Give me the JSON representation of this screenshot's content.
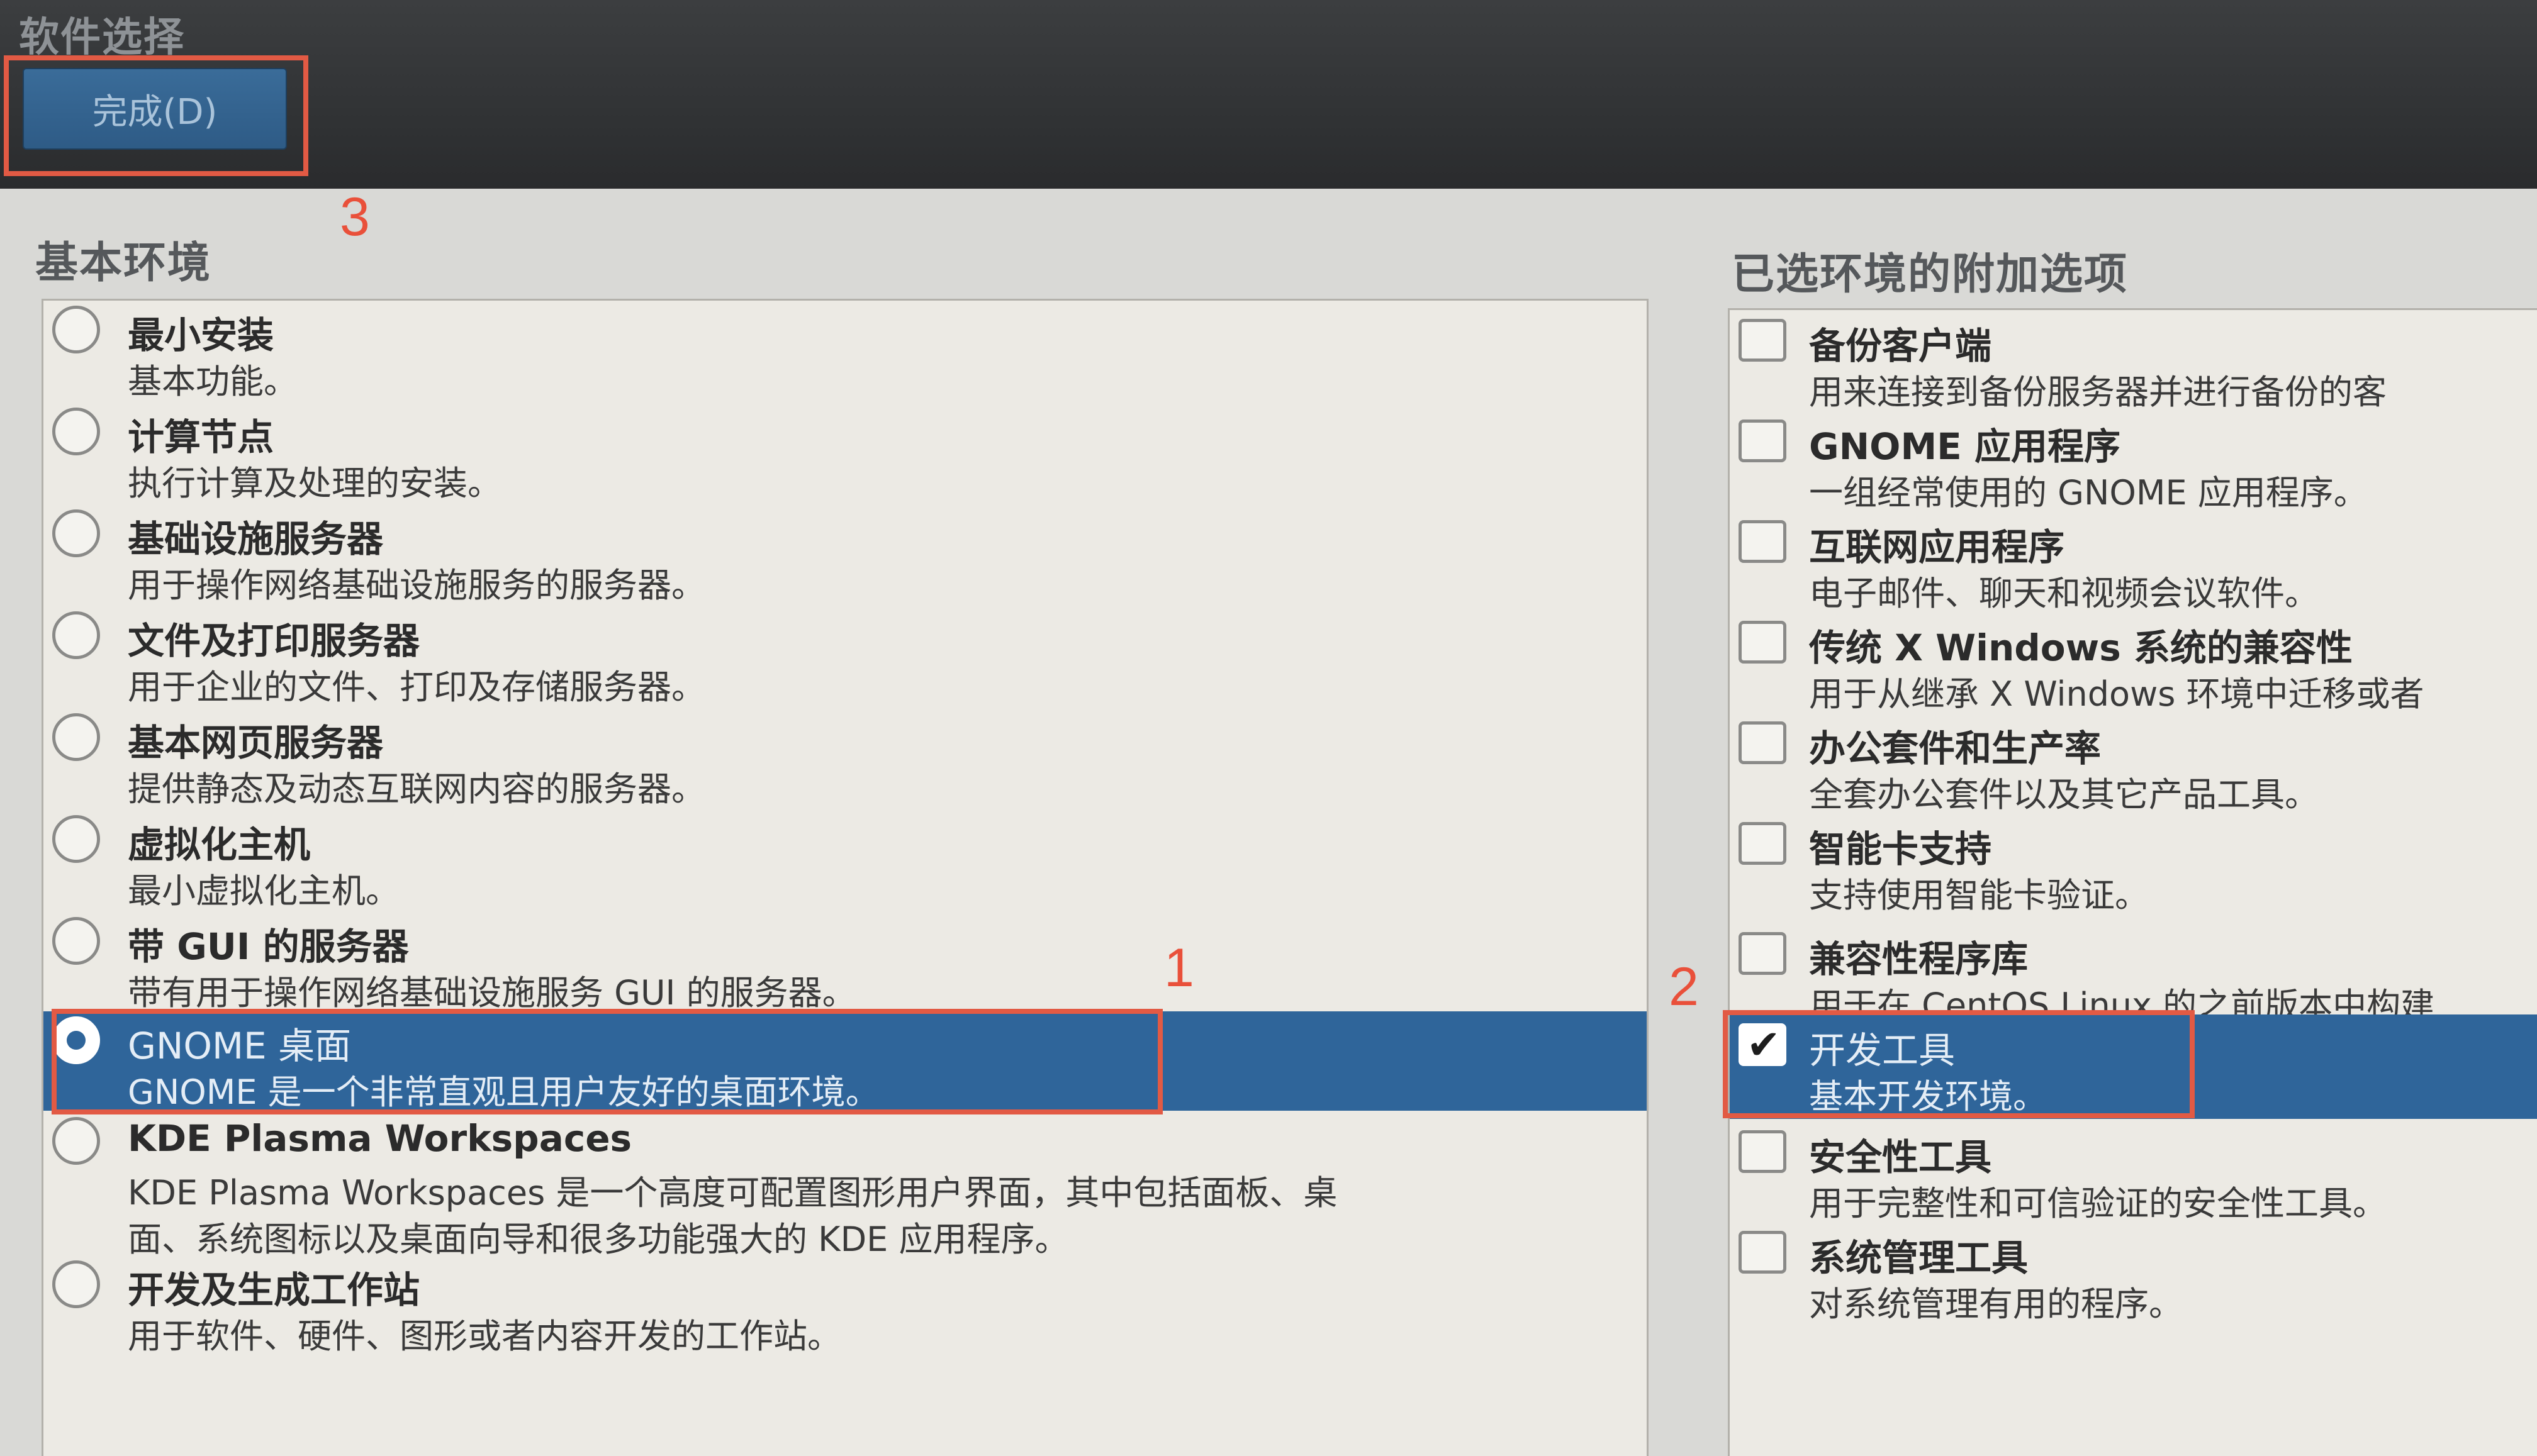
{
  "header": {
    "title": "软件选择",
    "done_button": "完成(D)"
  },
  "annotations": {
    "n1": "1",
    "n2": "2",
    "n3": "3",
    "color": "#e25a44"
  },
  "environments": {
    "label": "基本环境",
    "items": [
      {
        "title": "最小安装",
        "desc": "基本功能。",
        "selected": false
      },
      {
        "title": "计算节点",
        "desc": "执行计算及处理的安装。",
        "selected": false
      },
      {
        "title": "基础设施服务器",
        "desc": "用于操作网络基础设施服务的服务器。",
        "selected": false
      },
      {
        "title": "文件及打印服务器",
        "desc": "用于企业的文件、打印及存储服务器。",
        "selected": false
      },
      {
        "title": "基本网页服务器",
        "desc": "提供静态及动态互联网内容的服务器。",
        "selected": false
      },
      {
        "title": "虚拟化主机",
        "desc": "最小虚拟化主机。",
        "selected": false
      },
      {
        "title": "带 GUI 的服务器",
        "desc": "带有用于操作网络基础设施服务 GUI 的服务器。",
        "selected": false
      },
      {
        "title": "GNOME 桌面",
        "desc": "GNOME 是一个非常直观且用户友好的桌面环境。",
        "selected": true
      },
      {
        "title": "KDE Plasma Workspaces",
        "desc": "KDE Plasma Workspaces 是一个高度可配置图形用户界面，其中包括面板、桌",
        "desc2": "面、系统图标以及桌面向导和很多功能强大的 KDE 应用程序。",
        "selected": false
      },
      {
        "title": "开发及生成工作站",
        "desc": "用于软件、硬件、图形或者内容开发的工作站。",
        "selected": false
      }
    ]
  },
  "addons": {
    "label": "已选环境的附加选项",
    "items": [
      {
        "title": "备份客户端",
        "desc": "用来连接到备份服务器并进行备份的客",
        "checked": false
      },
      {
        "title": "GNOME 应用程序",
        "desc": "一组经常使用的 GNOME 应用程序。",
        "checked": false
      },
      {
        "title": "互联网应用程序",
        "desc": "电子邮件、聊天和视频会议软件。",
        "checked": false
      },
      {
        "title": "传统 X Windows 系统的兼容性",
        "desc": "用于从继承 X Windows 环境中迁移或者",
        "checked": false
      },
      {
        "title": "办公套件和生产率",
        "desc": "全套办公套件以及其它产品工具。",
        "checked": false
      },
      {
        "title": "智能卡支持",
        "desc": "支持使用智能卡验证。",
        "checked": false
      },
      {
        "title": "兼容性程序库",
        "desc": "用于在 CentOS Linux 的之前版本中构建",
        "checked": false
      },
      {
        "title": "开发工具",
        "desc": "基本开发环境。",
        "checked": true
      },
      {
        "title": "安全性工具",
        "desc": "用于完整性和可信验证的安全性工具。",
        "checked": false
      },
      {
        "title": "系统管理工具",
        "desc": "对系统管理有用的程序。",
        "checked": false
      }
    ]
  }
}
